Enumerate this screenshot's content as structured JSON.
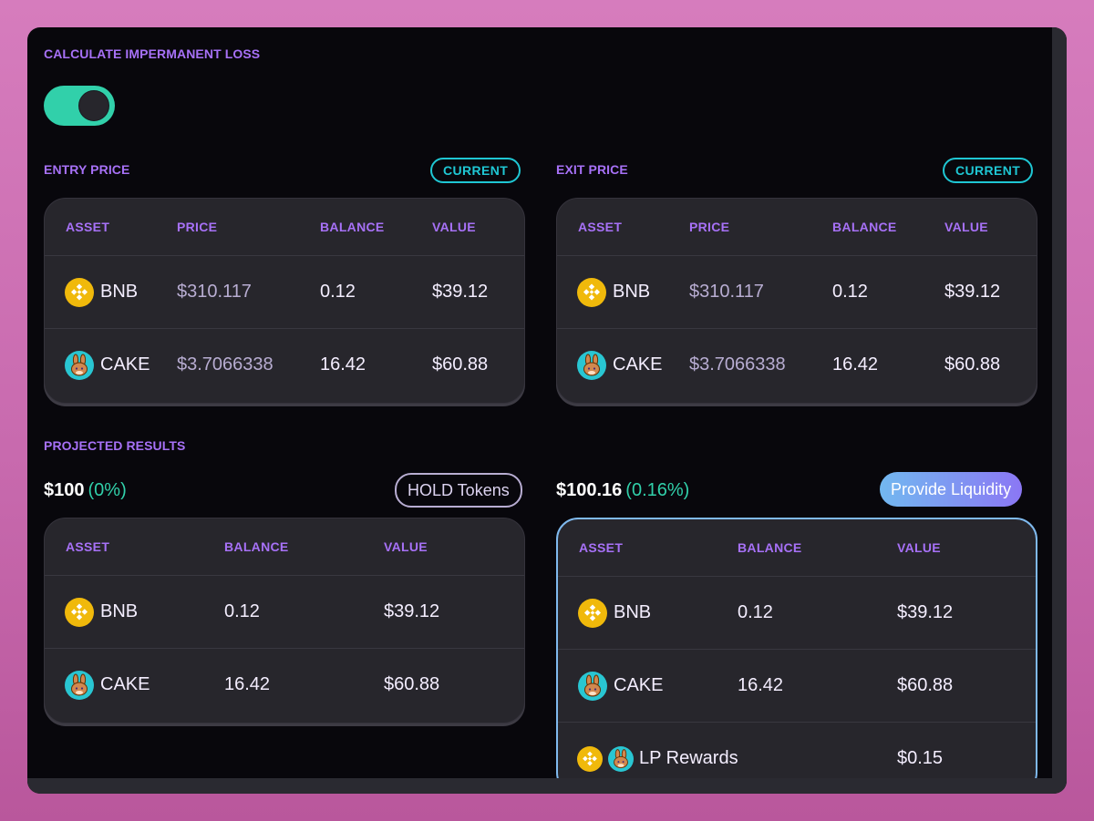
{
  "calculator": {
    "title": "CALCULATE IMPERMANENT LOSS",
    "toggle_on": true
  },
  "entry": {
    "heading": "ENTRY PRICE",
    "pill": "CURRENT",
    "headers": {
      "asset": "ASSET",
      "price": "PRICE",
      "balance": "BALANCE",
      "value": "VALUE"
    },
    "rows": [
      {
        "asset": "BNB",
        "icon": "bnb-coin-icon",
        "price": "$310.117",
        "balance": "0.12",
        "value": "$39.12"
      },
      {
        "asset": "CAKE",
        "icon": "cake-coin-icon",
        "price": "$3.7066338",
        "balance": "16.42",
        "value": "$60.88"
      }
    ]
  },
  "exit": {
    "heading": "EXIT PRICE",
    "pill": "CURRENT",
    "headers": {
      "asset": "ASSET",
      "price": "PRICE",
      "balance": "BALANCE",
      "value": "VALUE"
    },
    "rows": [
      {
        "asset": "BNB",
        "icon": "bnb-coin-icon",
        "price": "$310.117",
        "balance": "0.12",
        "value": "$39.12"
      },
      {
        "asset": "CAKE",
        "icon": "cake-coin-icon",
        "price": "$3.7066338",
        "balance": "16.42",
        "value": "$60.88"
      }
    ]
  },
  "projected": {
    "heading": "PROJECTED RESULTS",
    "hold": {
      "total": "$100",
      "change": "(0%)",
      "button": "HOLD Tokens",
      "headers": {
        "asset": "ASSET",
        "balance": "BALANCE",
        "value": "VALUE"
      },
      "rows": [
        {
          "asset": "BNB",
          "balance": "0.12",
          "value": "$39.12"
        },
        {
          "asset": "CAKE",
          "balance": "16.42",
          "value": "$60.88"
        }
      ]
    },
    "liquidity": {
      "total": "$100.16",
      "change": "(0.16%)",
      "button": "Provide Liquidity",
      "headers": {
        "asset": "ASSET",
        "balance": "BALANCE",
        "value": "VALUE"
      },
      "rows": [
        {
          "asset": "BNB",
          "balance": "0.12",
          "value": "$39.12"
        },
        {
          "asset": "CAKE",
          "balance": "16.42",
          "value": "$60.88"
        }
      ],
      "rewards": {
        "label": "LP Rewards",
        "value": "$0.15"
      }
    }
  },
  "colors": {
    "accent_purple": "#a771f7",
    "accent_cyan": "#1fc7d4",
    "success_green": "#31d0aa",
    "bnb_yellow": "#f0b90b",
    "card_bg": "#27262c"
  }
}
